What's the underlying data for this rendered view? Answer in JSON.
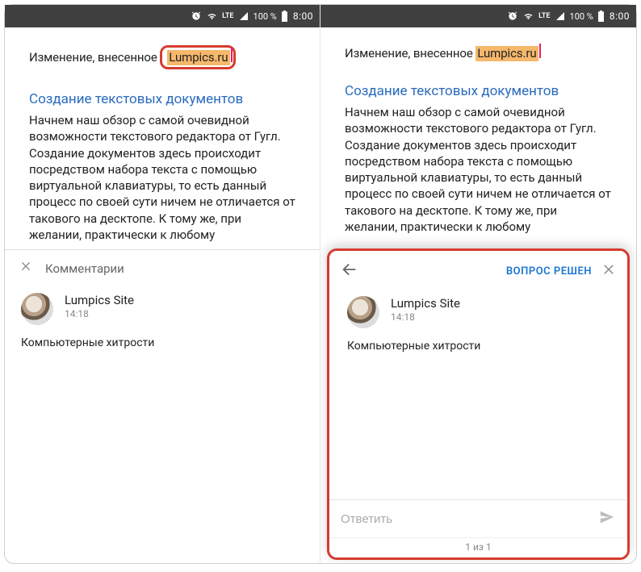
{
  "status": {
    "lte": "LTE",
    "battery": "100 %",
    "time": "8:00"
  },
  "doc": {
    "edit_prefix": "Изменение, внесенное ",
    "edit_author": "Lumpics.ru",
    "heading": "Создание текстовых документов",
    "paragraph": "Начнем наш обзор с самой очевидной возможности текстового редактора от Гугл. Создание документов здесь происходит посредством набора текста с помощью виртуальной клавиатуры, то есть данный процесс по своей сути ничем не отличается от такового на десктопе. К тому же, при желании, практически к любому"
  },
  "comments": {
    "title": "Комментарии",
    "author": "Lumpics Site",
    "time": "14:18",
    "text": "Компьютерные хитрости"
  },
  "detail": {
    "resolved_label": "ВОПРОС РЕШЕН",
    "reply_placeholder": "Ответить",
    "pager": "1 из 1"
  }
}
